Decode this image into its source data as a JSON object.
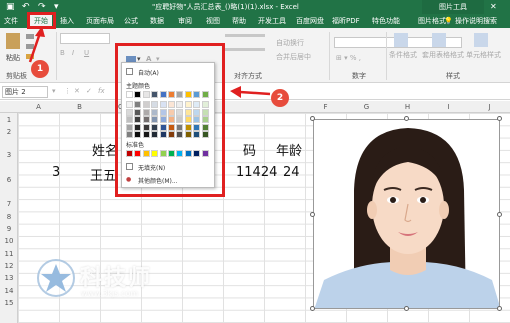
{
  "titlebar": {
    "filename": "\"应聘好物\"人员汇总表_()略(1)(1).xlsx  -  Excel",
    "context_label": "图片工具",
    "min": "–",
    "max": "□",
    "close": "✕"
  },
  "tabs": [
    {
      "label": "文件"
    },
    {
      "label": "开始"
    },
    {
      "label": "插入"
    },
    {
      "label": "页面布局"
    },
    {
      "label": "公式"
    },
    {
      "label": "数据"
    },
    {
      "label": "审阅"
    },
    {
      "label": "视图"
    },
    {
      "label": "帮助"
    },
    {
      "label": "开发工具"
    },
    {
      "label": "百度网盘"
    },
    {
      "label": "福昕PDF"
    },
    {
      "label": "特色功能"
    },
    {
      "label": "图片格式"
    }
  ],
  "tell_me": "操作说明搜索",
  "ribbon": {
    "paste": "粘贴",
    "clipboard_group": "剪贴板",
    "auto_wrap": "自动换行",
    "merge_center": "合并后居中",
    "align_group": "对齐方式",
    "number_group": "数字",
    "conditional": "条件格式",
    "table_format": "套用表格格式",
    "cell_style": "单元格样式",
    "styles_group": "样式"
  },
  "formula_bar": {
    "name_box": "图片 2"
  },
  "columns": [
    "A",
    "B",
    "C",
    "D",
    "E",
    "F",
    "G",
    "H",
    "I",
    "J"
  ],
  "rows": [
    "1",
    "2",
    "3",
    "6",
    "6",
    "7",
    "8",
    "9",
    "10",
    "11",
    "12",
    "13",
    "14",
    "15"
  ],
  "cells": {
    "name_header": "姓名",
    "code_header": "码",
    "age_header": "年龄",
    "index": "3",
    "name": "王五",
    "code": "11424",
    "age": "24"
  },
  "color_menu": {
    "automatic": "自动(A)",
    "theme_colors": "主题颜色",
    "standard_colors": "标准色",
    "no_fill": "无填充(N)",
    "more_colors": "其他颜色(M)..."
  },
  "colors": {
    "theme_top": [
      "#ffffff",
      "#000000",
      "#e7e6e6",
      "#44546a",
      "#4472c4",
      "#ed7d31",
      "#a5a5a5",
      "#ffc000",
      "#5b9bd5",
      "#70ad47"
    ],
    "theme_shades": [
      [
        "#f2f2f2",
        "#7f7f7f",
        "#d0cece",
        "#d6dce4",
        "#d9e2f3",
        "#fbe5d5",
        "#ededed",
        "#fff2cc",
        "#deebf6",
        "#e2efd9"
      ],
      [
        "#d8d8d8",
        "#595959",
        "#aeabab",
        "#adb9ca",
        "#b4c6e7",
        "#f7cbac",
        "#dbdbdb",
        "#fee599",
        "#bdd7ee",
        "#c5e0b3"
      ],
      [
        "#bfbfbf",
        "#3f3f3f",
        "#757070",
        "#8496b0",
        "#8eaadb",
        "#f4b183",
        "#c9c9c9",
        "#ffd966",
        "#9cc3e5",
        "#a8d08d"
      ],
      [
        "#a5a5a5",
        "#262626",
        "#3a3838",
        "#323f4f",
        "#2f5496",
        "#c55a11",
        "#7b7b7b",
        "#bf8f00",
        "#2e75b5",
        "#538135"
      ],
      [
        "#7f7f7f",
        "#0c0c0c",
        "#171616",
        "#222a35",
        "#1f3864",
        "#833c0b",
        "#525252",
        "#7f6000",
        "#1e4e79",
        "#375623"
      ]
    ],
    "standard": [
      "#c00000",
      "#ff0000",
      "#ffc000",
      "#ffff00",
      "#92d050",
      "#00b050",
      "#00b0f0",
      "#0070c0",
      "#002060",
      "#7030a0"
    ],
    "excel_green": "#217346",
    "annotation_red": "#e02020"
  },
  "annotations": {
    "step1": "1",
    "step2": "2"
  },
  "watermark": {
    "brand": "科技师",
    "url": "www.3kjs.com"
  }
}
